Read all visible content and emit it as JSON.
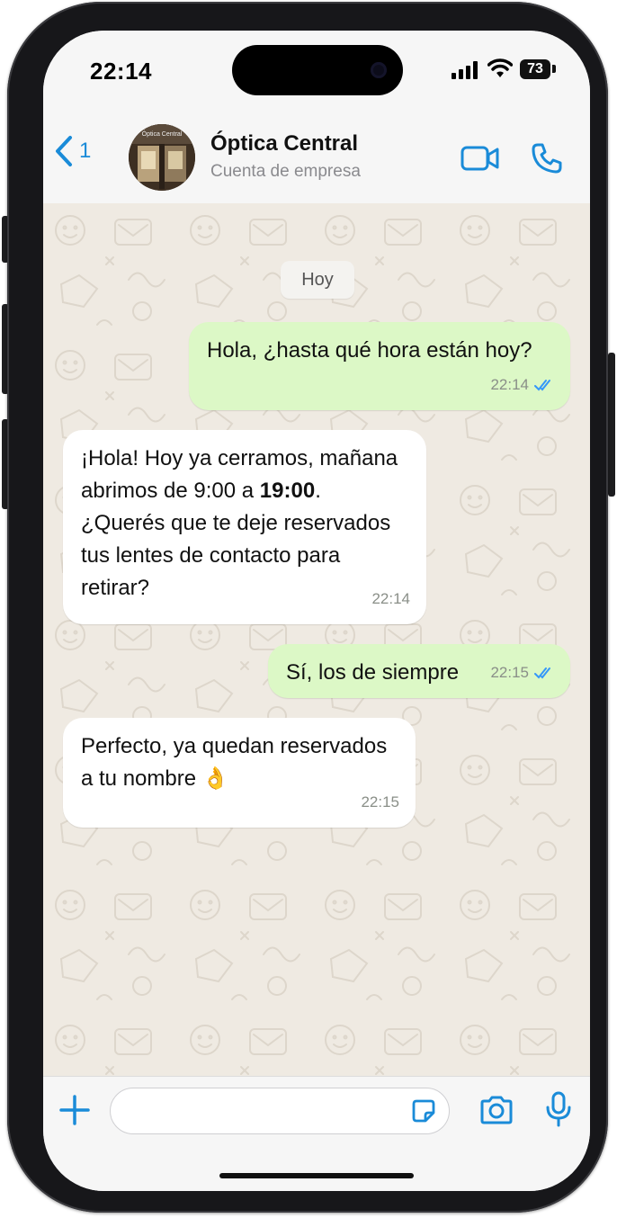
{
  "status_bar": {
    "time": "22:14",
    "battery": "73"
  },
  "header": {
    "back_count": "1",
    "avatar_sign": "Óptica Central",
    "contact_name": "Óptica Central",
    "contact_subtitle": "Cuenta de empresa"
  },
  "chat": {
    "date_chip": "Hoy",
    "messages": [
      {
        "direction": "outgoing",
        "text": "Hola, ¿hasta qué hora están hoy?",
        "time": "22:14",
        "read": true
      },
      {
        "direction": "incoming",
        "text_before": "¡Hola! Hoy ya cerramos, mañana abrimos de 9:00 a ",
        "text_bold": "19:00",
        "text_after": ". ¿Querés que te deje reservados tus lentes de contacto para retirar?",
        "time": "22:14"
      },
      {
        "direction": "outgoing",
        "text": "Sí, los de siempre",
        "time": "22:15",
        "read": true
      },
      {
        "direction": "incoming",
        "text": "Perfecto, ya quedan reservados a tu nombre",
        "emoji": "👌",
        "time": "22:15"
      }
    ]
  },
  "composer": {
    "placeholder": ""
  },
  "colors": {
    "accent": "#1a8bd8",
    "outgoing_bubble": "#dcf8c6",
    "incoming_bubble": "#ffffff",
    "wallpaper": "#efeae2",
    "read_ticks": "#3497f9"
  },
  "icons": [
    "back-chevron-icon",
    "video-call-icon",
    "phone-call-icon",
    "plus-icon",
    "sticker-icon",
    "camera-icon",
    "microphone-icon",
    "read-ticks-icon",
    "cellular-signal-icon",
    "wifi-icon"
  ]
}
